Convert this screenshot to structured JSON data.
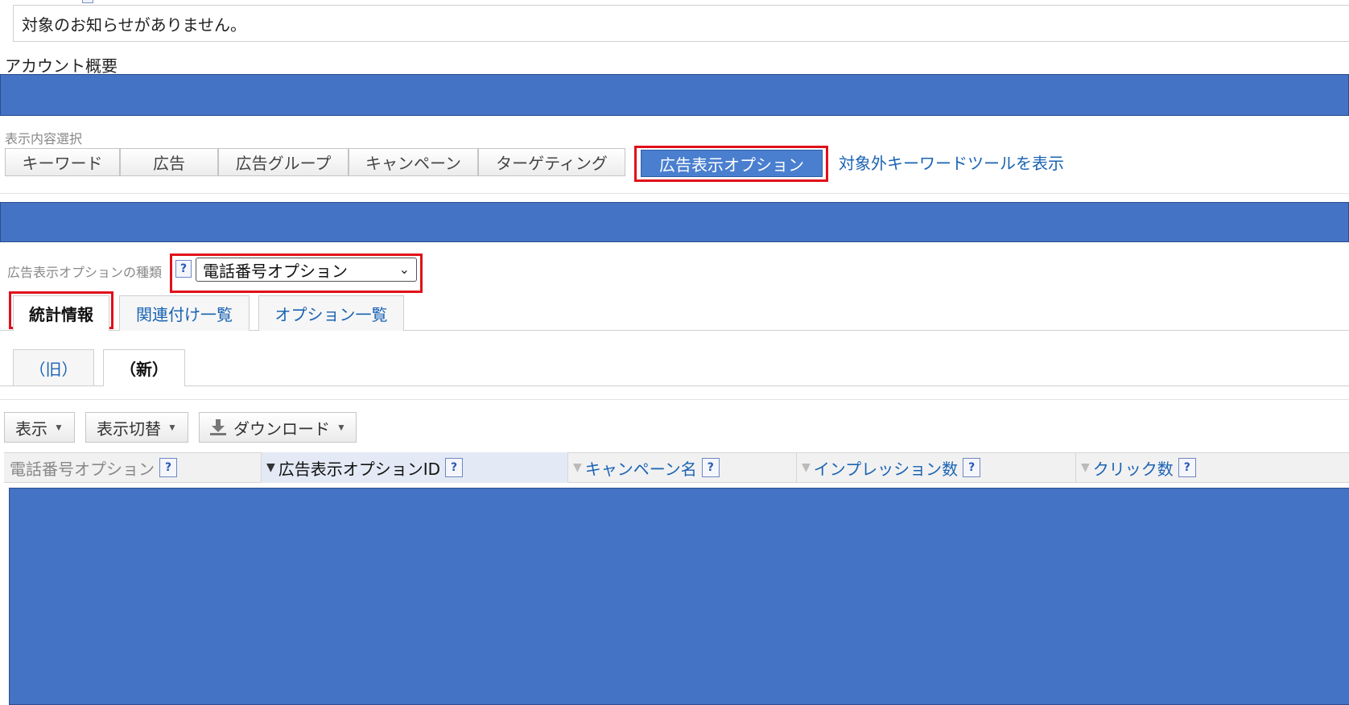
{
  "notice": {
    "text": "対象のお知らせがありません。"
  },
  "account_overview": {
    "title": "アカウント概要"
  },
  "display_selection": {
    "label": "表示内容選択",
    "buttons": [
      {
        "label": "キーワード"
      },
      {
        "label": "広告"
      },
      {
        "label": "広告グループ"
      },
      {
        "label": "キャンペーン"
      },
      {
        "label": "ターゲティング"
      },
      {
        "label": "広告表示オプション",
        "active": true
      }
    ],
    "link": "対象外キーワードツールを表示"
  },
  "option_type": {
    "label": "広告表示オプションの種類",
    "help": "?",
    "selected": "電話番号オプション"
  },
  "tabs": [
    {
      "label": "統計情報",
      "active": true
    },
    {
      "label": "関連付け一覧"
    },
    {
      "label": "オプション一覧"
    }
  ],
  "subtabs": [
    {
      "label": "（旧）"
    },
    {
      "label": "（新）",
      "active": true
    }
  ],
  "toolbar": {
    "display": "表示",
    "switch": "表示切替",
    "download": "ダウンロード"
  },
  "table": {
    "columns": [
      {
        "label": "電話番号オプション"
      },
      {
        "label": "広告表示オプションID",
        "sorted": true
      },
      {
        "label": "キャンペーン名"
      },
      {
        "label": "インプレッション数"
      },
      {
        "label": "クリック数"
      }
    ],
    "help": "?"
  },
  "colors": {
    "band": "#4472c4",
    "active_button": "#4a7fd0",
    "highlight": "#e0101a",
    "link": "#1a63b3"
  }
}
